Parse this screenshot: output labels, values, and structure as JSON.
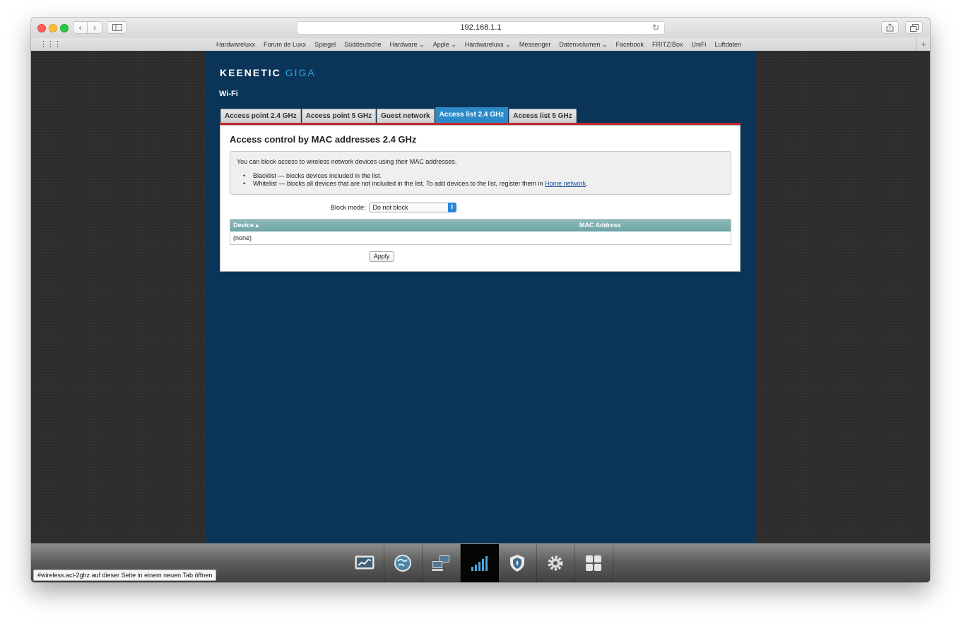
{
  "browser": {
    "url": "192.168.1.1",
    "bookmarks": [
      "Hardwareluxx",
      "Forum de Luxx",
      "Spiegel",
      "Süddeutsche",
      "Hardware ⌄",
      "Apple ⌄",
      "Hardwareluxx ⌄",
      "Messenger",
      "Datenvolumen ⌄",
      "Facebook",
      "FRITZ!Box",
      "UniFi",
      "Luftdaten"
    ],
    "status_url": "#wireless.acl-2ghz auf dieser Seite in einem neuen Tab öffnen"
  },
  "router": {
    "logo_main": "KEENETIC",
    "logo_sub": "GIGA",
    "section_title": "Wi-Fi",
    "tabs": [
      {
        "label": "Access point 2.4 GHz",
        "active": false
      },
      {
        "label": "Access point 5 GHz",
        "active": false
      },
      {
        "label": "Guest network",
        "active": false
      },
      {
        "label": "Access list 2.4 GHz",
        "active": true
      },
      {
        "label": "Access list 5 GHz",
        "active": false
      }
    ],
    "panel": {
      "title": "Access control by MAC addresses 2.4 GHz",
      "intro": "You can block access to wireless network devices using their MAC addresses.",
      "blacklist": "Blacklist — blocks devices included in the list.",
      "whitelist_prefix": "Whitelist — blocks all devices that are not included in the list. To add devices to the list, register them in ",
      "whitelist_link": "Home network",
      "whitelist_suffix": ".",
      "block_mode_label": "Block mode:",
      "block_mode_value": "Do not block",
      "table": {
        "columns": [
          "Device ▴",
          "MAC Address"
        ],
        "rows": [
          "(none)"
        ]
      },
      "apply_label": "Apply"
    },
    "bottom_nav": [
      {
        "icon": "monitor-chart-icon",
        "active": false
      },
      {
        "icon": "globe-icon",
        "active": false
      },
      {
        "icon": "network-computers-icon",
        "active": false
      },
      {
        "icon": "wifi-signal-icon",
        "active": true
      },
      {
        "icon": "shield-icon",
        "active": false
      },
      {
        "icon": "gear-icon",
        "active": false
      },
      {
        "icon": "apps-grid-icon",
        "active": false
      }
    ]
  }
}
